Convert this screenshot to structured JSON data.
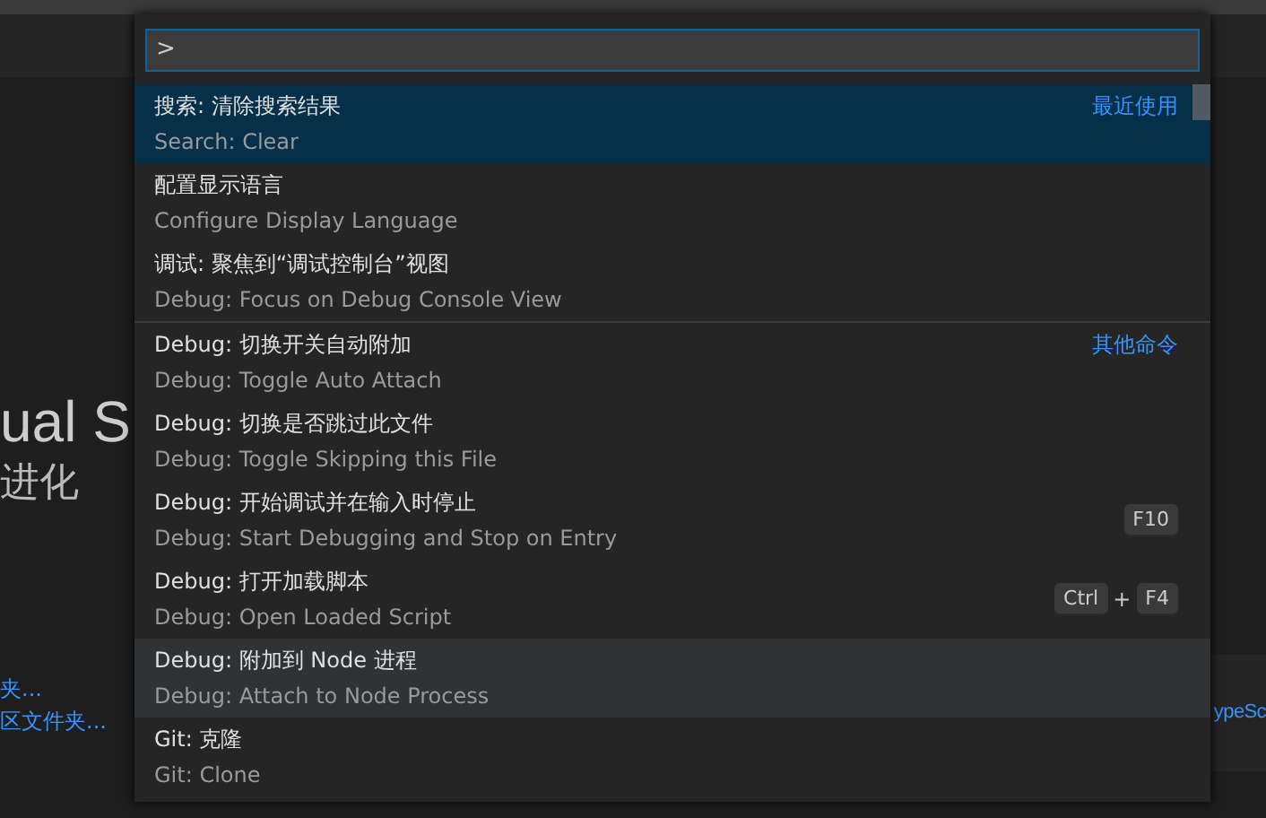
{
  "background": {
    "title": "ual S",
    "subtitle": "进化",
    "links": [
      "夹...",
      "区文件夹..."
    ],
    "right_link": "ypeSc"
  },
  "command_palette": {
    "value": ">",
    "groups": [
      {
        "label": "最近使用",
        "items": [
          {
            "title": "搜索: 清除搜索结果",
            "detail": "Search: Clear",
            "selected": true,
            "hovered": false
          },
          {
            "title": "配置显示语言",
            "detail": "Configure Display Language",
            "selected": false,
            "hovered": false
          },
          {
            "title": "调试: 聚焦到“调试控制台”视图",
            "detail": "Debug: Focus on Debug Console View",
            "selected": false,
            "hovered": false
          }
        ]
      },
      {
        "label": "其他命令",
        "items": [
          {
            "title": "Debug: 切换开关自动附加",
            "detail": "Debug: Toggle Auto Attach",
            "selected": false,
            "hovered": false
          },
          {
            "title": "Debug: 切换是否跳过此文件",
            "detail": "Debug: Toggle Skipping this File",
            "selected": false,
            "hovered": false
          },
          {
            "title": "Debug: 开始调试并在输入时停止",
            "detail": "Debug: Start Debugging and Stop on Entry",
            "selected": false,
            "hovered": false,
            "keys": [
              "F10"
            ]
          },
          {
            "title": "Debug: 打开加载脚本",
            "detail": "Debug: Open Loaded Script",
            "selected": false,
            "hovered": false,
            "keys": [
              "Ctrl",
              "+",
              "F4"
            ]
          },
          {
            "title": "Debug: 附加到 Node 进程",
            "detail": "Debug: Attach to Node Process",
            "selected": false,
            "hovered": true
          },
          {
            "title": "Git: 克隆",
            "detail": "Git: Clone",
            "selected": false,
            "hovered": false
          }
        ]
      }
    ]
  }
}
